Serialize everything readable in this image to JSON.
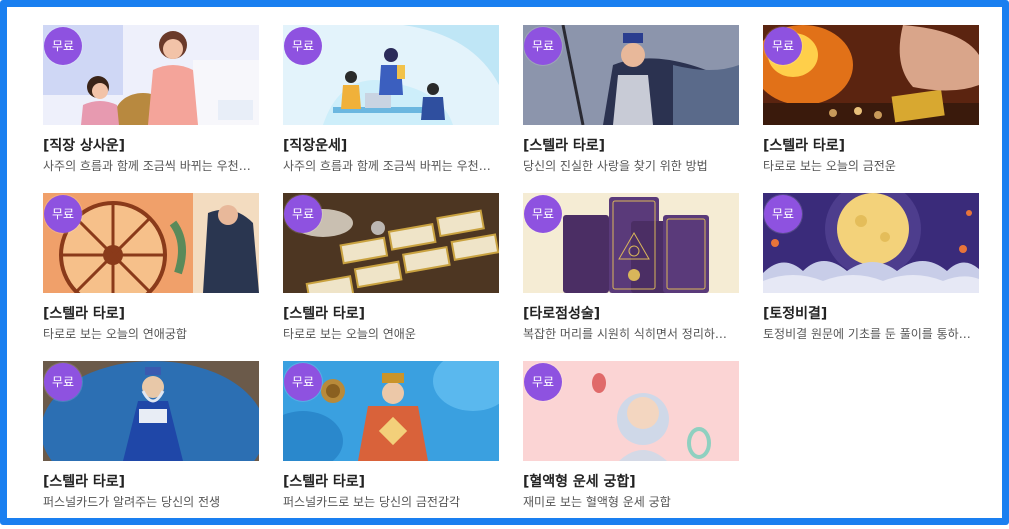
{
  "badge_label": "무료",
  "colors": {
    "frame": "#1a7ff0",
    "badge": "#8e52e0"
  },
  "cards": [
    {
      "title": "[직장 상사운]",
      "desc": "사주의 흐름과 함께 조금씩 바뀌는 우천…",
      "image": "office-boss-illustration"
    },
    {
      "title": "[직장운세]",
      "desc": "사주의 흐름과 함께 조금씩 바뀌는 우천…",
      "image": "office-meeting-illustration"
    },
    {
      "title": "[스텔라 타로]",
      "desc": "당신의 진실한 사랑을 찾기 위한 방법",
      "image": "tarot-king-card"
    },
    {
      "title": "[스텔라 타로]",
      "desc": "타로로 보는 오늘의 금전운",
      "image": "tarot-hand-spread"
    },
    {
      "title": "[스텔라 타로]",
      "desc": "타로로 보는 오늘의 연애궁합",
      "image": "tarot-wheel-card"
    },
    {
      "title": "[스텔라 타로]",
      "desc": "타로로 보는 오늘의 연애운",
      "image": "tarot-cards-on-table"
    },
    {
      "title": "[타로점성술]",
      "desc": "복잡한 머리를 시원히 식히면서 정리하…",
      "image": "tarot-three-cards"
    },
    {
      "title": "[토정비결]",
      "desc": "토정비결 원문에 기초를 둔 풀이를 통하…",
      "image": "full-moon-night"
    },
    {
      "title": "[스텔라 타로]",
      "desc": "퍼스널카드가 알려주는 당신의 전생",
      "image": "tarot-queen-blue"
    },
    {
      "title": "[스텔라 타로]",
      "desc": "퍼스널카드로 보는 당신의 금전감각",
      "image": "tarot-queen-coin"
    },
    {
      "title": "[혈액형 운세 궁합]",
      "desc": "재미로 보는 혈액형 운세 궁합",
      "image": "blood-type-letters"
    }
  ]
}
